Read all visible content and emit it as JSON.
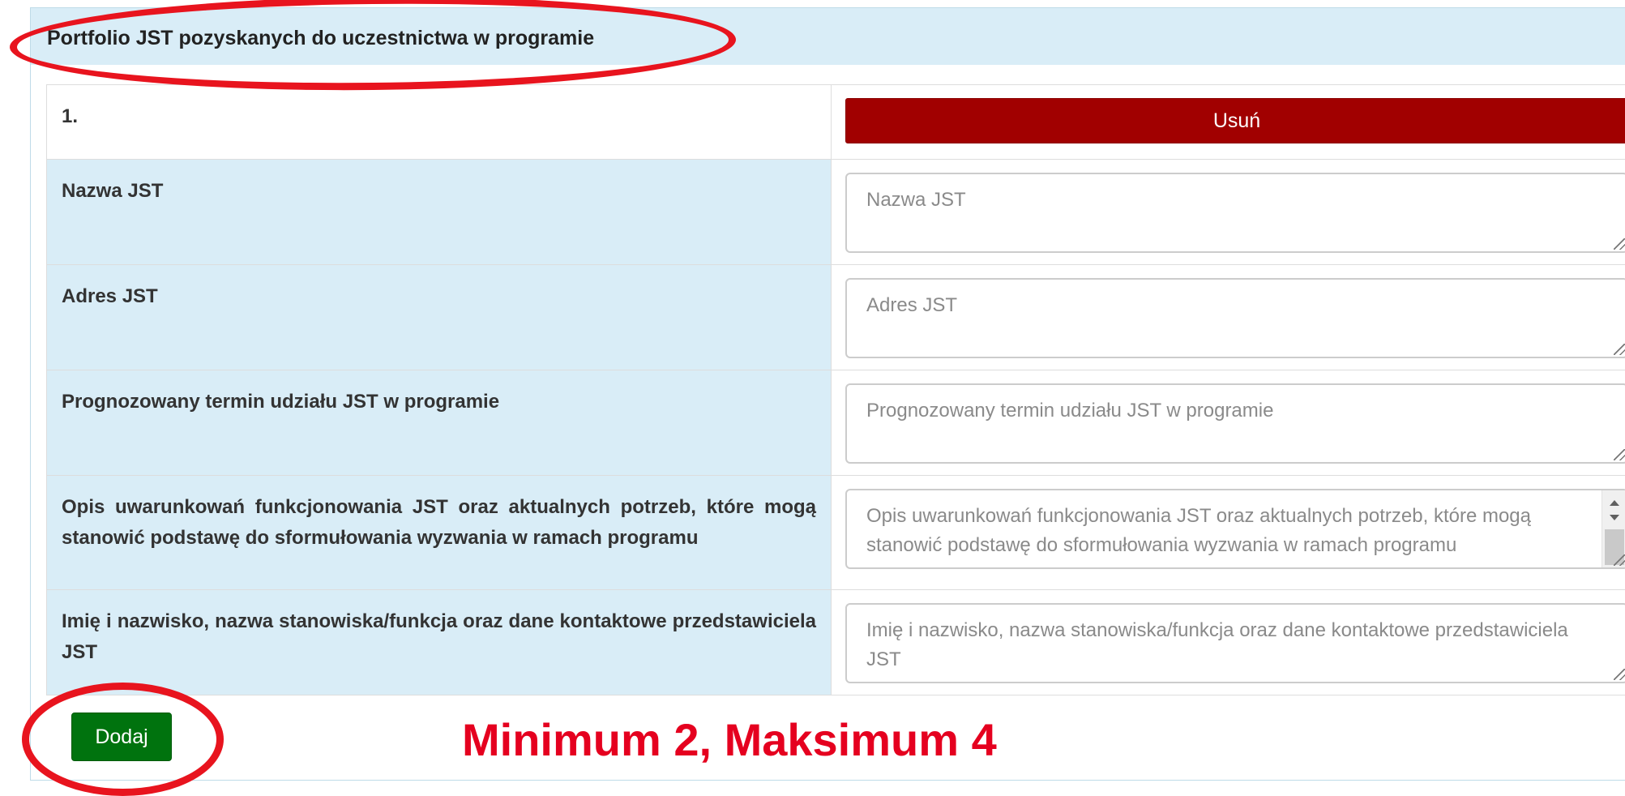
{
  "panel": {
    "title": "Portfolio JST pozyskanych do uczestnictwa w programie"
  },
  "entry": {
    "number": "1.",
    "delete_label": "Usuń",
    "fields": [
      {
        "label": "Nazwa JST",
        "placeholder": "Nazwa JST",
        "value": ""
      },
      {
        "label": "Adres JST",
        "placeholder": "Adres JST",
        "value": ""
      },
      {
        "label": "Prognozowany termin udziału JST w programie",
        "placeholder": "Prognozowany termin udziału JST w programie",
        "value": ""
      },
      {
        "label": "Opis uwarunkowań funkcjonowania JST oraz aktualnych potrzeb, które mogą stanowić podstawę do sformułowania wyzwania w ramach programu",
        "placeholder": "Opis uwarunkowań funkcjonowania JST oraz aktualnych potrzeb, które mogą stanowić podstawę do sformułowania wyzwania w ramach programu",
        "value": ""
      },
      {
        "label": "Imię i nazwisko, nazwa stanowiska/funkcja oraz dane kontaktowe przedstawiciela JST",
        "placeholder": "Imię i nazwisko, nazwa stanowiska/funkcja oraz dane kontaktowe przedstawiciela JST",
        "value": ""
      }
    ]
  },
  "add_label": "Dodaj",
  "annotation_note": "Minimum 2, Maksimum 4",
  "colors": {
    "header_bg": "#d9edf7",
    "delete_button": "#a10000",
    "add_button": "#00730e",
    "annotation_red": "#e8141e"
  },
  "icons": [
    "resize-grip-icon",
    "scroll-up-arrow-icon",
    "scroll-down-arrow-icon"
  ]
}
